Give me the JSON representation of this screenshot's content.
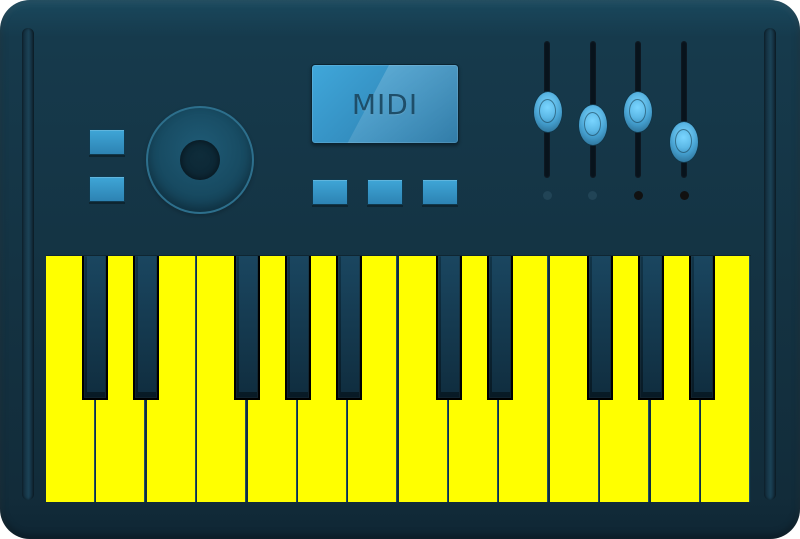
{
  "display": {
    "text": "MIDI"
  },
  "colors": {
    "body": "#163a4c",
    "accent_blue": "#3fa6d7",
    "white_keys": "#ffff00",
    "black_keys": "#0f2f40"
  },
  "controls": {
    "left_buttons": 2,
    "bottom_buttons": 3,
    "faders": [
      {
        "name": "fader-1",
        "led": "dim"
      },
      {
        "name": "fader-2",
        "led": "dim"
      },
      {
        "name": "fader-3",
        "led": "on"
      },
      {
        "name": "fader-4",
        "led": "on"
      }
    ],
    "fader_levels": [
      0.52,
      0.4,
      0.52,
      0.26
    ]
  },
  "keyboard": {
    "white_key_count": 14,
    "black_key_count": 10
  }
}
